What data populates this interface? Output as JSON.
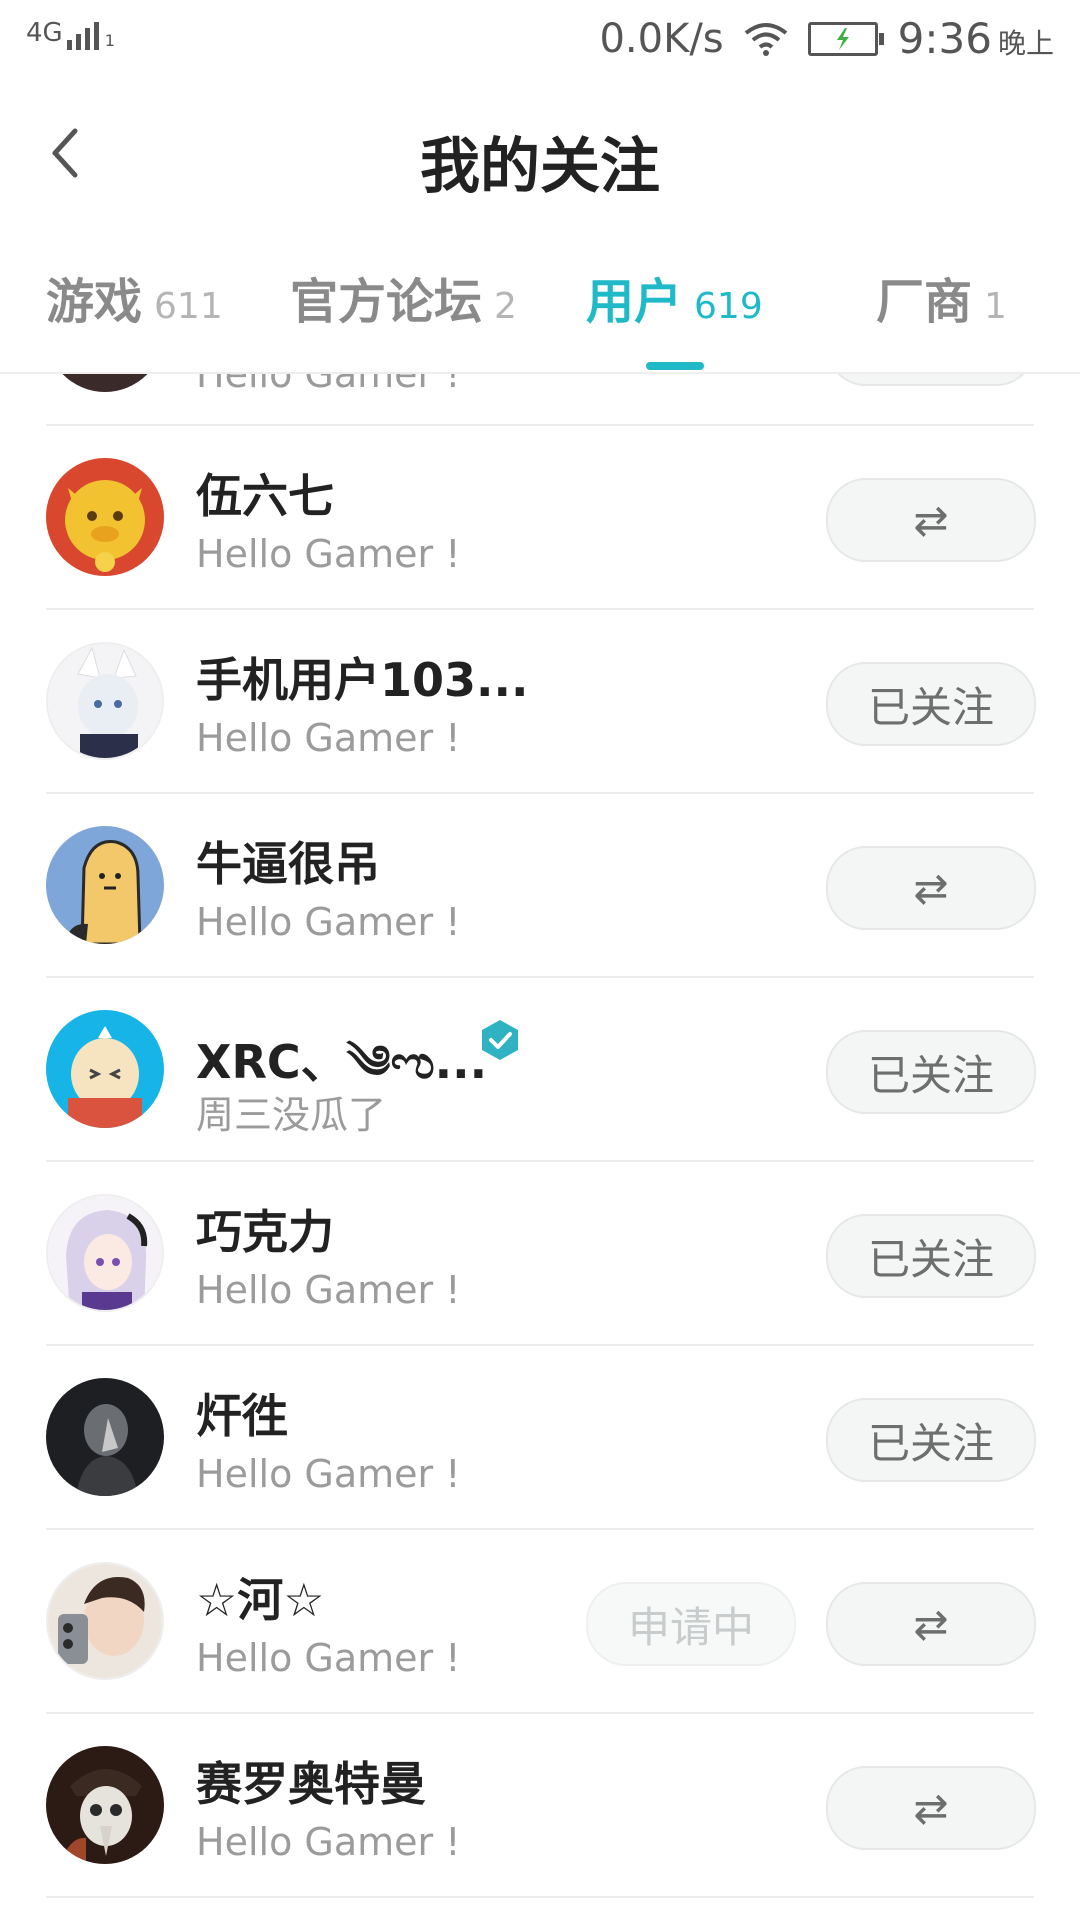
{
  "status_bar": {
    "network": "4G",
    "sub": "1",
    "speed": "0.0K/s",
    "time": "9:36",
    "ampm": "晚上"
  },
  "header": {
    "title": "我的关注",
    "back_icon": "chevron-left-icon"
  },
  "tabs": [
    {
      "label": "游戏",
      "count": "611"
    },
    {
      "label": "官方论坛",
      "count": "2"
    },
    {
      "label": "用户",
      "count": "619",
      "active": true
    },
    {
      "label": "厂商",
      "count": "1"
    }
  ],
  "colors": {
    "accent": "#1fb9c8",
    "verified": "#2fb3c2"
  },
  "list": {
    "partial_top": {
      "sub": "Hello Gamer !"
    },
    "rows": [
      {
        "name": "伍六七",
        "sub": "Hello Gamer !",
        "button": "⇄",
        "avatar": "golden-cow-avatar"
      },
      {
        "name": "手机用户103...",
        "sub": "Hello Gamer !",
        "button": "已关注",
        "avatar": "fox-girl-avatar"
      },
      {
        "name": "牛逼很吊",
        "sub": "Hello Gamer !",
        "button": "⇄",
        "avatar": "potato-avatar"
      },
      {
        "name": "XRC、༄ಌ...",
        "sub": "周三没瓜了",
        "button": "已关注",
        "verified": true,
        "avatar": "egg-avatar"
      },
      {
        "name": "巧克力",
        "sub": "Hello Gamer !",
        "button": "已关注",
        "avatar": "anime-girl-avatar"
      },
      {
        "name": "㶥徃",
        "sub": "Hello Gamer !",
        "button": "已关注",
        "avatar": "dark-figure-avatar"
      },
      {
        "name": "☆河☆",
        "sub": "Hello Gamer !",
        "pending": "申请中",
        "button": "⇄",
        "avatar": "photo-avatar"
      },
      {
        "name": "赛罗奥特曼",
        "sub": "Hello Gamer !",
        "button": "⇄",
        "avatar": "mask-avatar"
      }
    ]
  }
}
